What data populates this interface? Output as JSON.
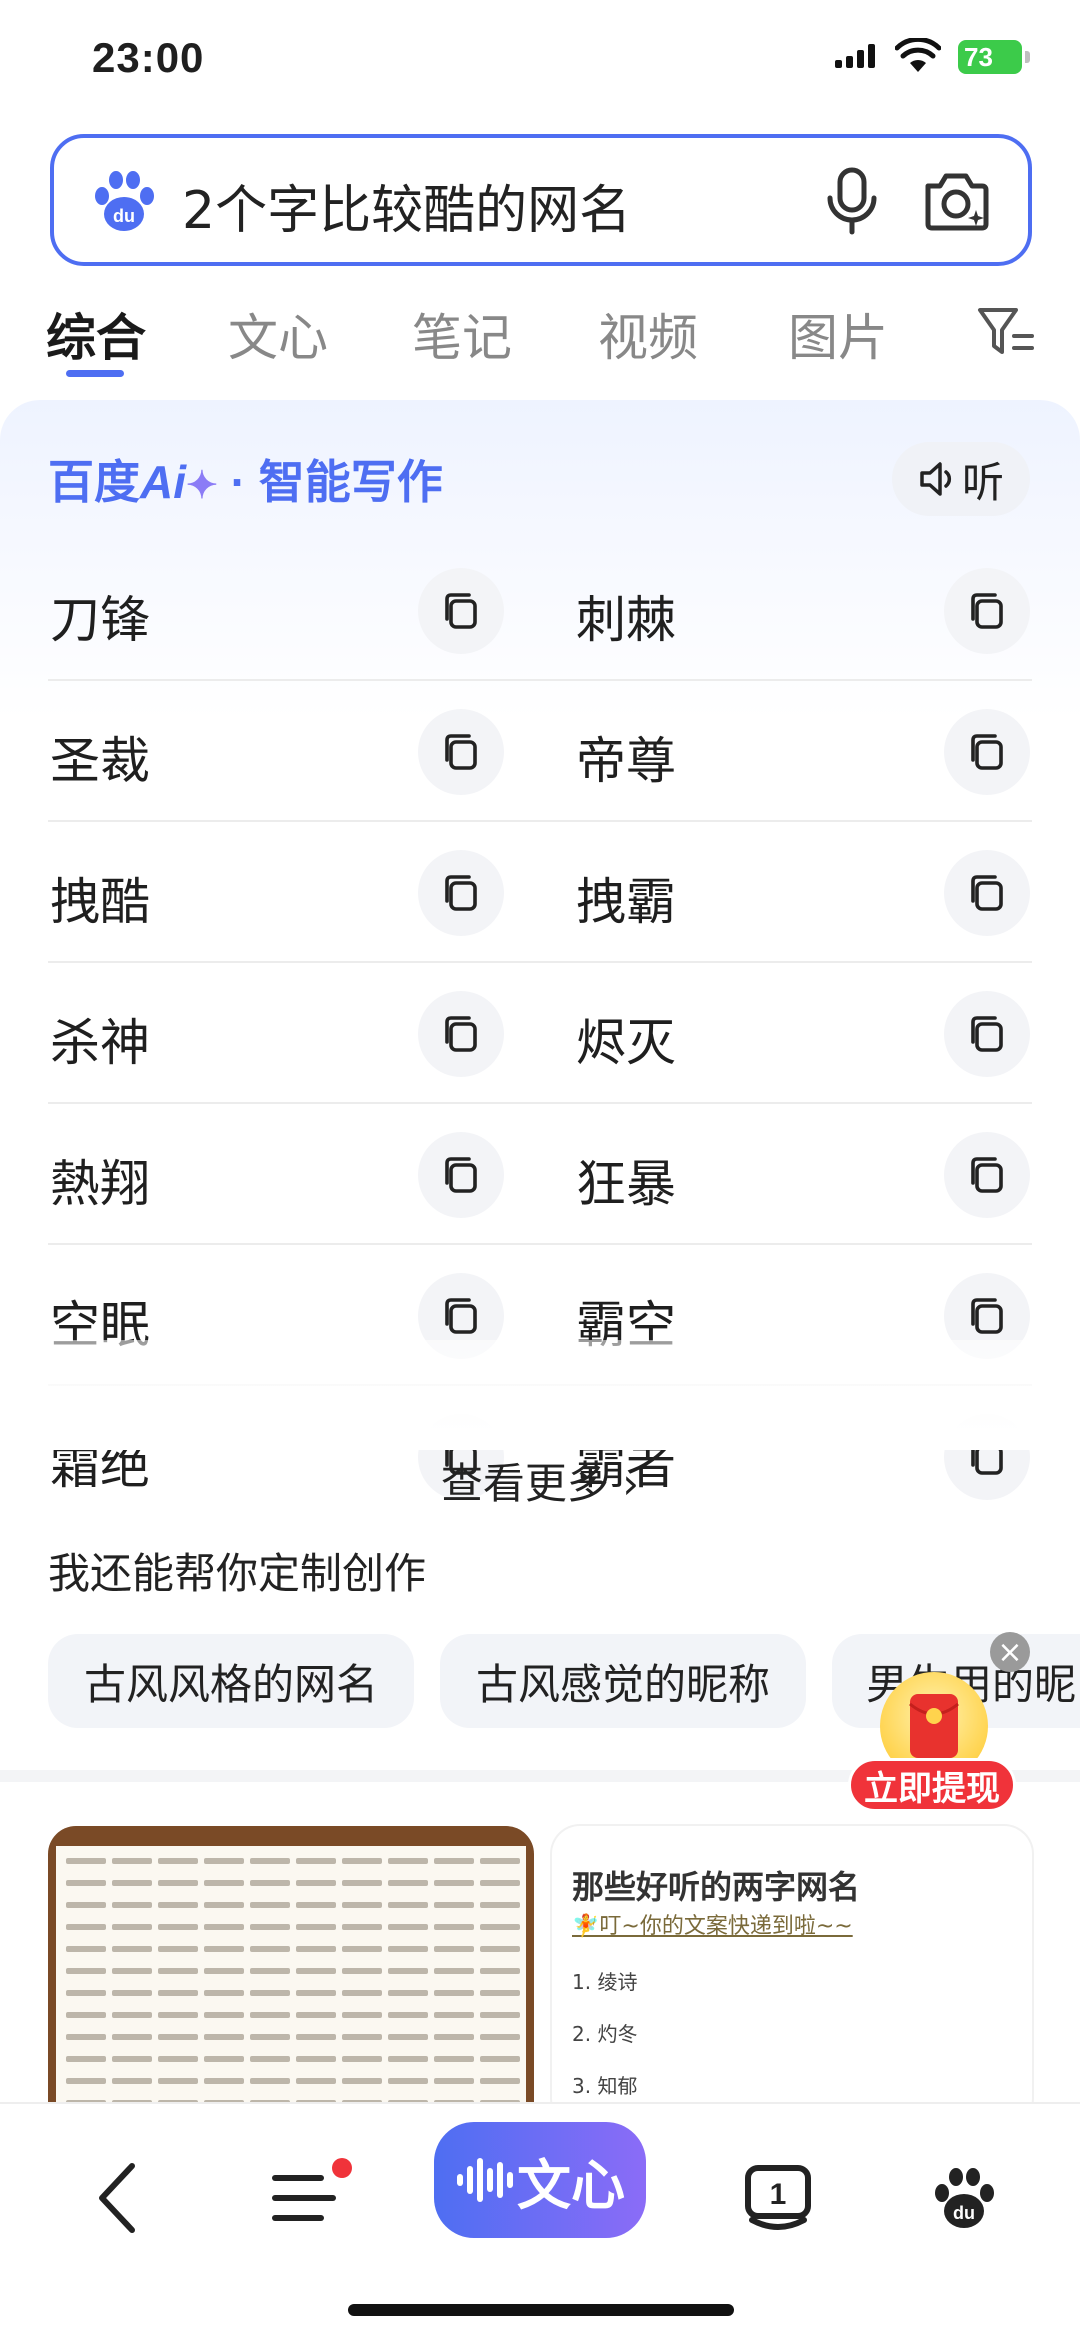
{
  "status_bar": {
    "time": "23:00",
    "battery": "73"
  },
  "search": {
    "query": "2个字比较酷的网名"
  },
  "tabs": [
    "综合",
    "文心",
    "笔记",
    "视频",
    "图片"
  ],
  "ai_card": {
    "brand": "百度",
    "brand_ai": "Ai",
    "brand_spark": "✦",
    "brand_suffix": " · 智能写作",
    "listen_label": "听",
    "names": [
      [
        "刀锋",
        "刺棘"
      ],
      [
        "圣裁",
        "帝尊"
      ],
      [
        "拽酷",
        "拽霸"
      ],
      [
        "杀神",
        "烬灭"
      ],
      [
        "熱翔",
        "狂暴"
      ],
      [
        "空眠",
        "霸空"
      ],
      [
        "霜绝",
        "霸者"
      ]
    ],
    "more_label": "查看更多 ›",
    "custom_title": "我还能帮你定制创作",
    "chips": [
      "古风风格的网名",
      "古风感觉的昵称",
      "男生用的昵"
    ]
  },
  "floating": {
    "close": "×",
    "withdraw_label": "立即提现"
  },
  "result": {
    "title": "那些好听的两字网名",
    "subtitle": "🧚叮~你的文案快递到啦~~",
    "items": [
      "1. 绫诗",
      "2. 灼冬",
      "3. 知郁"
    ]
  },
  "bottom_nav": {
    "wenxin_label": "文心",
    "tab_count": "1"
  },
  "colors": {
    "accent": "#4e6ef2",
    "red": "#f0333a"
  }
}
